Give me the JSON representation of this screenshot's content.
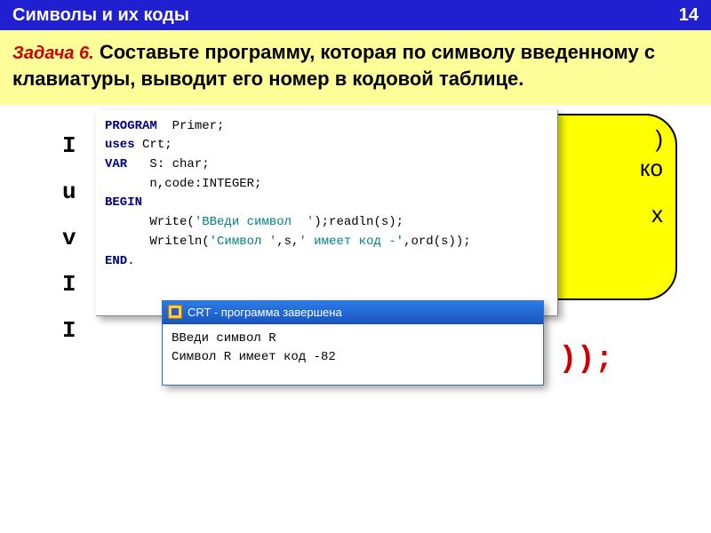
{
  "header": {
    "title": "Символы  и их коды",
    "page_number": "14"
  },
  "task": {
    "label": "Задача 6.",
    "text": "Составьте программу, которая по символу введенному с клавиатуры, выводит его номер в кодовой таблице."
  },
  "bg": {
    "left_frags": [
      "I",
      "u",
      "v",
      "I",
      "I"
    ],
    "bubble_frags": [
      ")",
      "ко",
      "х"
    ],
    "red_frag": "));"
  },
  "editor": {
    "lines": [
      {
        "kw": "PROGRAM",
        "rest": "  Primer;"
      },
      {
        "kw": "uses",
        "rest": " Crt;"
      },
      {
        "kw": "VAR",
        "rest": "   S: char;"
      },
      {
        "kw": "",
        "rest": "      n,code:INTEGER;"
      },
      {
        "kw": "BEGIN",
        "rest": ""
      },
      {
        "kw": "",
        "write1a": "      Write(",
        "str1": "'ВВеди символ  '",
        "mid1": ");readln(s);"
      },
      {
        "kw": "",
        "write2a": "      Writeln(",
        "str2a": "'Символ '",
        "mid2a": ",s,",
        "str2b": "' имеет код -'",
        "mid2b": ",ord(s));"
      },
      {
        "kw": "END",
        "rest": "."
      }
    ]
  },
  "terminal": {
    "title": "CRT - программа завершена",
    "line1": "ВВеди символ  R",
    "line2": "Символ R имеет код -82"
  }
}
